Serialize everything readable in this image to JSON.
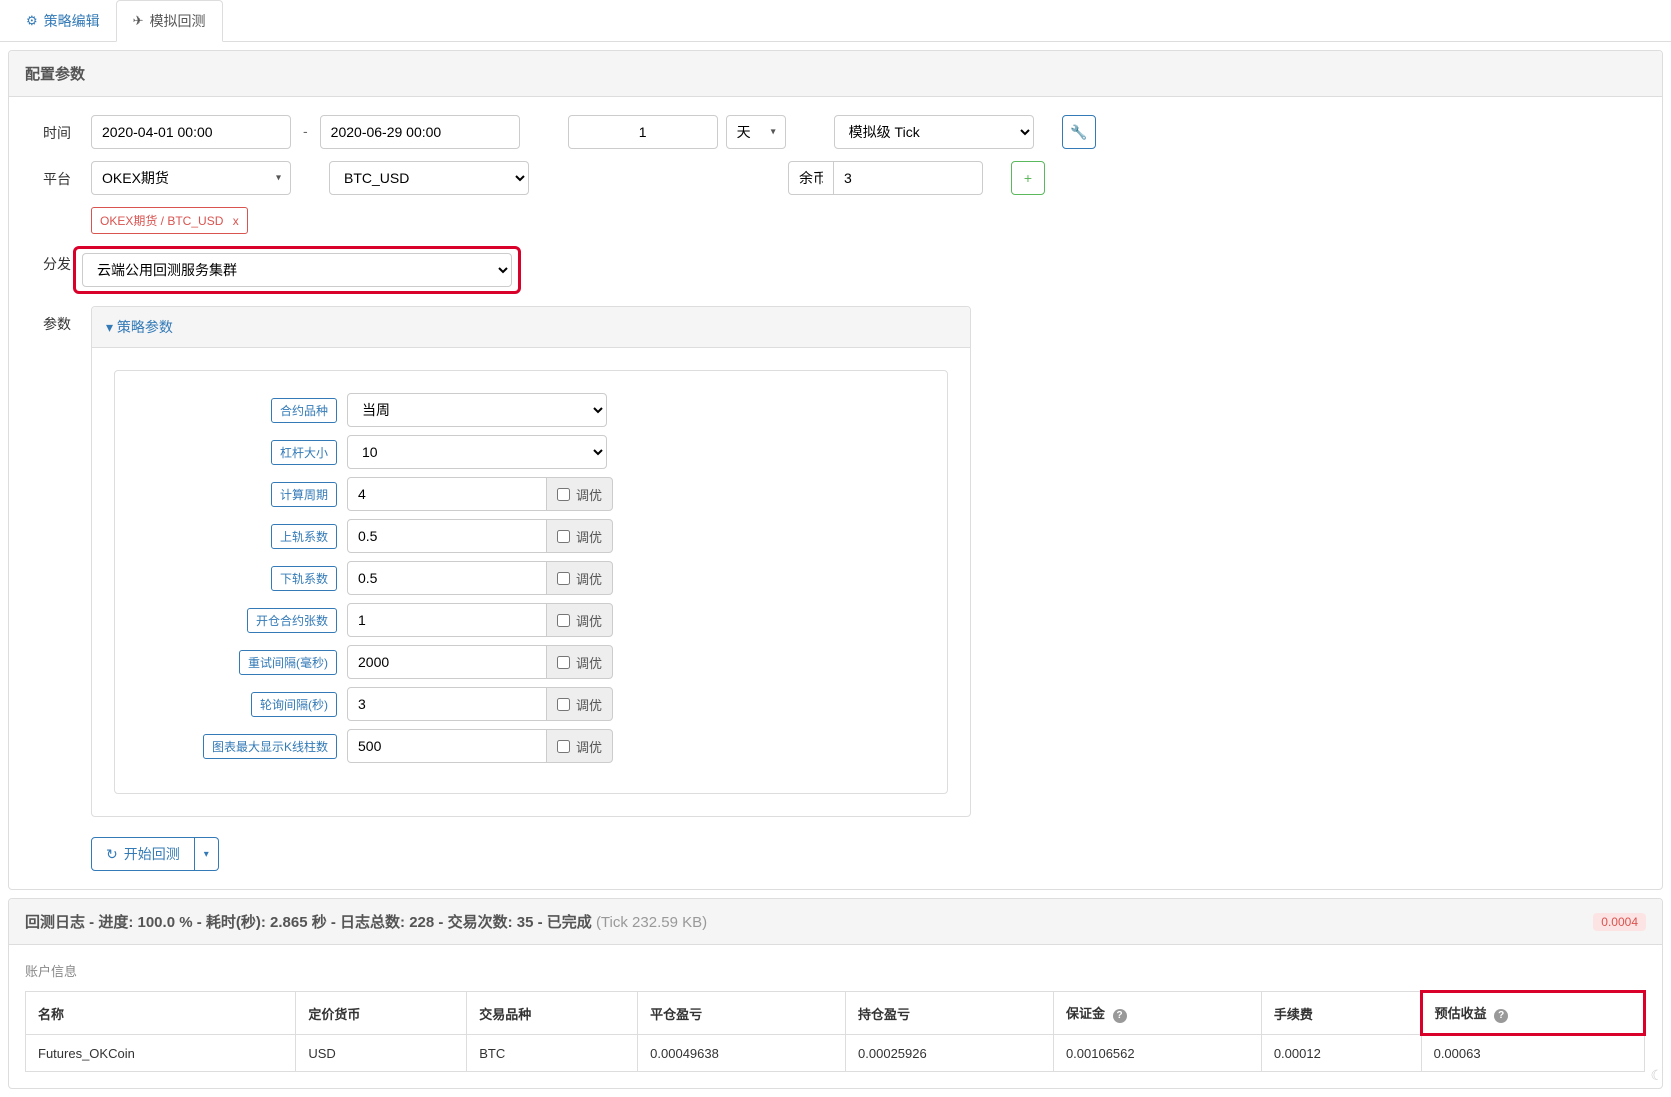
{
  "tabs": {
    "edit": "策略编辑",
    "backtest": "模拟回测"
  },
  "config": {
    "title": "配置参数",
    "labels": {
      "time": "时间",
      "platform": "平台",
      "dispatch": "分发",
      "params": "参数",
      "balance": "余币"
    },
    "time_from": "2020-04-01 00:00",
    "time_to": "2020-06-29 00:00",
    "period_value": "1",
    "period_unit": "天",
    "tick_level": "模拟级 Tick",
    "platform": "OKEX期货",
    "symbol": "BTC_USD",
    "balance_value": "3",
    "pair_tag": "OKEX期货 / BTC_USD",
    "pair_tag_close": "x",
    "dispatch_value": "云端公用回测服务集群",
    "strategy_params_header": "策略参数"
  },
  "strategy_params": [
    {
      "label": "合约品种",
      "value": "当周",
      "type": "select",
      "opt": false
    },
    {
      "label": "杠杆大小",
      "value": "10",
      "type": "select",
      "opt": false
    },
    {
      "label": "计算周期",
      "value": "4",
      "type": "text",
      "opt": true
    },
    {
      "label": "上轨系数",
      "value": "0.5",
      "type": "text",
      "opt": true
    },
    {
      "label": "下轨系数",
      "value": "0.5",
      "type": "text",
      "opt": true
    },
    {
      "label": "开仓合约张数",
      "value": "1",
      "type": "text",
      "opt": true
    },
    {
      "label": "重试间隔(毫秒)",
      "value": "2000",
      "type": "text",
      "opt": true
    },
    {
      "label": "轮询间隔(秒)",
      "value": "3",
      "type": "text",
      "opt": true
    },
    {
      "label": "图表最大显示K线柱数",
      "value": "500",
      "type": "text",
      "opt": true
    }
  ],
  "opt_label": "调优",
  "start_button": "开始回测",
  "log": {
    "title_prefix": "回测日志 - 进度: 100.0 % - 耗时(秒): 2.865 秒 - 日志总数: 228 - 交易次数: 35 - 已完成",
    "title_suffix": "(Tick 232.59 KB)",
    "badge": "0.0004",
    "account_info": "账户信息",
    "headers": {
      "name": "名称",
      "quote": "定价货币",
      "trade": "交易品种",
      "closed": "平仓盈亏",
      "holding": "持仓盈亏",
      "margin": "保证金",
      "fee": "手续费",
      "est": "预估收益"
    },
    "row": {
      "name": "Futures_OKCoin",
      "quote": "USD",
      "trade": "BTC",
      "closed": "0.00049638",
      "holding": "0.00025926",
      "margin": "0.00106562",
      "fee": "0.00012",
      "est": "0.00063"
    }
  }
}
